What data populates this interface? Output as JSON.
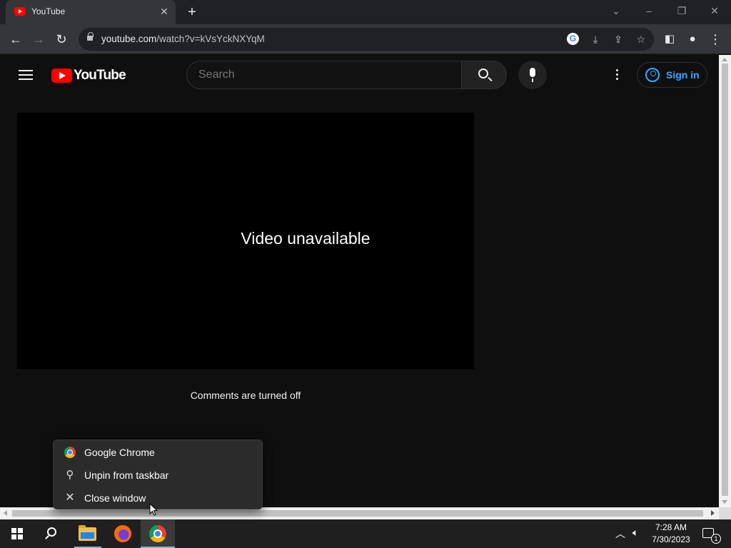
{
  "browser": {
    "tab_title": "YouTube",
    "url_host": "youtube.com",
    "url_path": "/watch?v=kVsYckNXYqM"
  },
  "youtube": {
    "logo_text": "YouTube",
    "search_placeholder": "Search",
    "signin_label": "Sign in",
    "player_message": "Video unavailable",
    "comments_message": "Comments are turned off"
  },
  "jumplist": {
    "items": [
      {
        "label": "Google Chrome",
        "icon": "chrome-icon"
      },
      {
        "label": "Unpin from taskbar",
        "icon": "unpin-icon"
      },
      {
        "label": "Close window",
        "icon": "close-icon"
      }
    ]
  },
  "taskbar": {
    "time": "7:28 AM",
    "date": "7/30/2023",
    "notification_count": "1"
  },
  "colors": {
    "youtube_red": "#ff0000",
    "link_blue": "#3ea6ff",
    "page_bg": "#0f0f0f"
  }
}
